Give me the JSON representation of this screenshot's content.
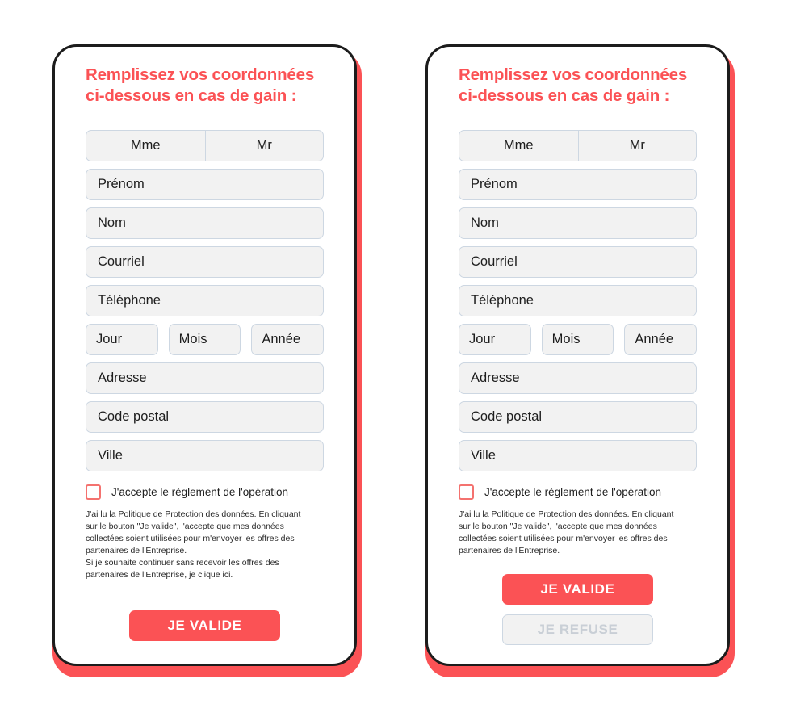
{
  "form": {
    "title": "Remplissez vos coordonnées\nci-dessous en cas de gain :",
    "salutation": {
      "mme_label": "Mme",
      "mr_label": "Mr"
    },
    "fields": [
      {
        "name": "prenom",
        "placeholder": "Prénom"
      },
      {
        "name": "nom",
        "placeholder": "Nom"
      },
      {
        "name": "courriel",
        "placeholder": "Courriel"
      },
      {
        "name": "telephone",
        "placeholder": "Téléphone"
      }
    ],
    "birthdate": [
      {
        "name": "jour",
        "placeholder": "Jour"
      },
      {
        "name": "mois",
        "placeholder": "Mois"
      },
      {
        "name": "annee",
        "placeholder": "Année"
      }
    ],
    "address_fields": [
      {
        "name": "adresse",
        "placeholder": "Adresse"
      },
      {
        "name": "code_postal",
        "placeholder": "Code postal"
      },
      {
        "name": "ville",
        "placeholder": "Ville"
      }
    ],
    "consent_label": "J'accepte le règlement de l'opération",
    "consent_checked": false
  },
  "variant_a": {
    "fine_print": "J'ai lu la Politique de Protection des données. En cliquant\nsur le bouton \"Je valide\", j'accepte que mes données\ncollectées soient utilisées pour m'envoyer les offres des\npartenaires de l'Entreprise.\nSi je souhaite continuer sans recevoir les offres des\npartenaires de l'Entreprise, je clique ici.",
    "validate_label": "JE VALIDE"
  },
  "variant_b": {
    "fine_print": "J'ai lu la Politique de Protection des données. En cliquant\nsur le bouton \"Je valide\", j'accepte que mes données\ncollectées soient utilisées pour m'envoyer les offres des\npartenaires de l'Entreprise.",
    "validate_label": "JE VALIDE",
    "refuse_label": "JE REFUSE"
  },
  "colors": {
    "accent": "#FB5255",
    "card_border": "#1C1C1C",
    "field_bg": "#F2F2F2",
    "field_border": "#CDD7E2",
    "checkbox_border": "#F4726F",
    "refuse_text": "#C9CFD6",
    "page_bg": "#FFFFFF"
  }
}
